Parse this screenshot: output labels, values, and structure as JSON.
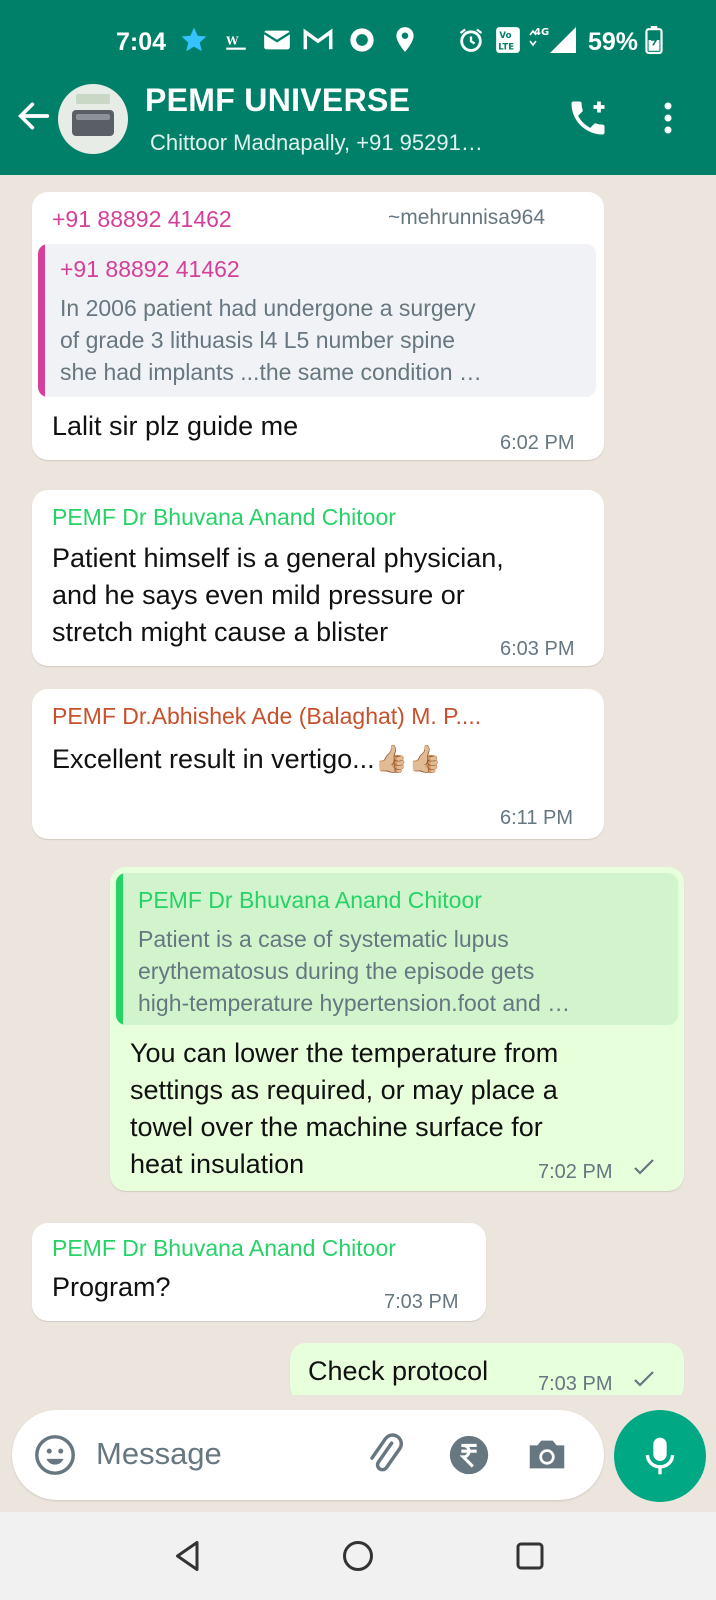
{
  "status_bar": {
    "time": "7:04",
    "battery": "59%",
    "icons": [
      "star-icon",
      "wp-app-icon",
      "mail-icon",
      "gmail-icon",
      "record-icon",
      "location-icon",
      "alarm-icon",
      "volte-icon",
      "signal-4g-icon",
      "battery-icon"
    ]
  },
  "header": {
    "title": "PEMF UNIVERSE",
    "subtitle": "Chittoor Madnapally, +91 95291…"
  },
  "messages": [
    {
      "sender": "+91 88892 41462",
      "sender_alias": "~mehrunnisa964",
      "quote_sender": "+91 88892 41462",
      "quote_lines": [
        "In 2006 patient had undergone a surgery",
        "of grade 3  lithuasis l4 L5 number spine",
        "she  had implants ...the same condition …"
      ],
      "text": "Lalit sir plz guide me",
      "time": "6:02 PM"
    },
    {
      "sender": "PEMF Dr Bhuvana Anand Chitoor",
      "lines": [
        "Patient himself is a general physician,",
        "and he says even mild pressure or",
        "stretch might cause a blister"
      ],
      "time": "6:03 PM"
    },
    {
      "sender": "PEMF Dr.Abhishek Ade (Balaghat) M. P....",
      "text": "Excellent result in vertigo...👍🏼👍🏼",
      "time": "6:11 PM"
    },
    {
      "quote_sender": "PEMF Dr Bhuvana Anand Chitoor",
      "quote_lines": [
        "Patient is a case of systematic lupus",
        "erythematosus during the episode gets",
        "high-temperature hypertension.foot and …"
      ],
      "lines": [
        "You can lower the temperature from",
        "settings as required, or may place a",
        "towel over the machine surface for",
        "heat insulation"
      ],
      "time": "7:02 PM"
    },
    {
      "sender": "PEMF Dr Bhuvana Anand Chitoor",
      "text": "Program?",
      "time": "7:03 PM"
    },
    {
      "text": "Check protocol",
      "time": "7:03 PM"
    }
  ],
  "input": {
    "placeholder": "Message"
  },
  "colors": {
    "header": "#008069",
    "pink_sender": "#d43f9a",
    "green_sender": "#25d366",
    "orange_sender": "#c8502c",
    "out_bubble": "#e7ffdb",
    "mic_button": "#00a884"
  }
}
